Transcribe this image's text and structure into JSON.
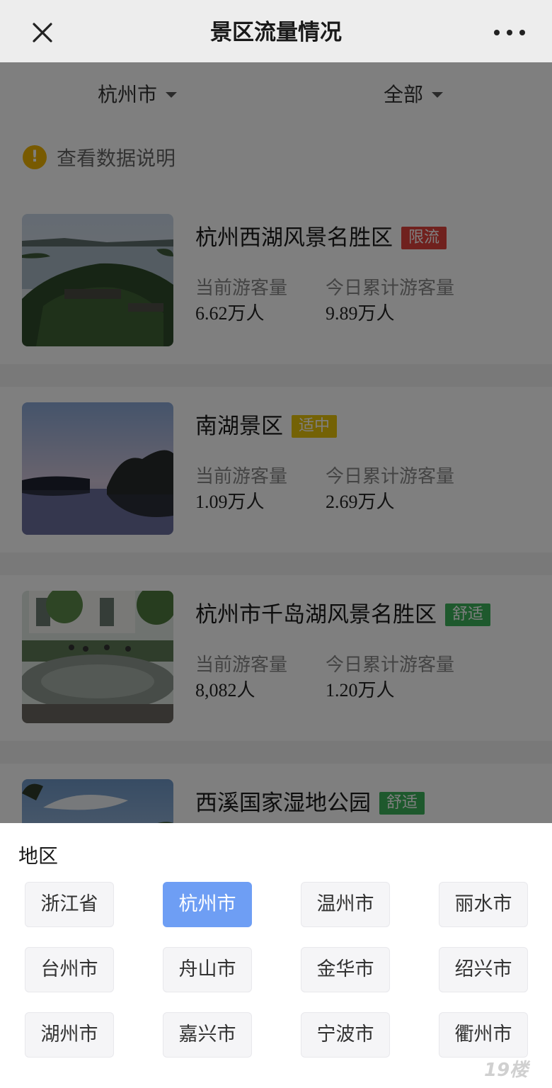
{
  "nav": {
    "title": "景区流量情况"
  },
  "filters": {
    "city": "杭州市",
    "level": "全部"
  },
  "notice": {
    "icon": "!",
    "text": "查看数据说明"
  },
  "labels": {
    "current": "当前游客量",
    "today": "今日累计游客量"
  },
  "spots": [
    {
      "name": "杭州西湖风景名胜区",
      "badge": "限流",
      "badge_color": "#e0433c",
      "current": "6.62万人",
      "today": "9.89万人"
    },
    {
      "name": "南湖景区",
      "badge": "适中",
      "badge_color": "#e8c40a",
      "current": "1.09万人",
      "today": "2.69万人"
    },
    {
      "name": "杭州市千岛湖风景名胜区",
      "badge": "舒适",
      "badge_color": "#3cb35a",
      "current": "8,082人",
      "today": "1.20万人"
    },
    {
      "name": "西溪国家湿地公园",
      "badge": "舒适",
      "badge_color": "#3cb35a"
    }
  ],
  "sheet": {
    "title": "地区",
    "regions": [
      "浙江省",
      "杭州市",
      "温州市",
      "丽水市",
      "台州市",
      "舟山市",
      "金华市",
      "绍兴市",
      "湖州市",
      "嘉兴市",
      "宁波市",
      "衢州市"
    ],
    "selected": "杭州市",
    "accent": "#6e9ef4"
  },
  "watermark": "19楼"
}
